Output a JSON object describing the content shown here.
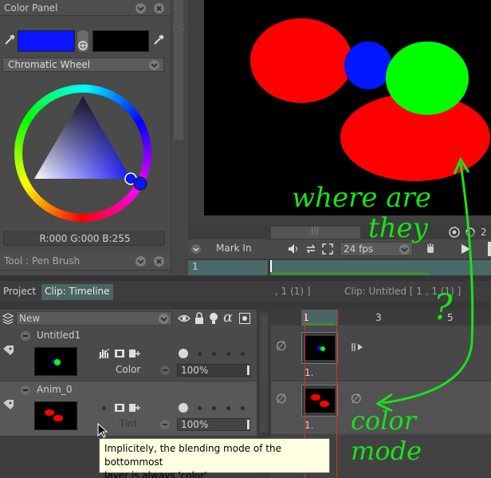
{
  "color_panel": {
    "title": "Color Panel",
    "mode_select": "Chromatic Wheel",
    "rgb_readout": "R:000 G:000 B:255",
    "primary_color": "#0a14ff",
    "secondary_color": "#000000"
  },
  "tool_panel": {
    "title": "Tool : Pen Brush"
  },
  "transport": {
    "mark_in": "Mark In",
    "fps": "24 fps",
    "current_frame": "1",
    "scroll_value": "2"
  },
  "tabs": {
    "project": "Project",
    "clip_timeline": "Clip: Timeline"
  },
  "timeline_status": {
    "frame_info": ", 1  (1)  ]",
    "clip_info": "Clip: Untitled [ 1 , 1  (1) ]"
  },
  "layer_header": {
    "new_label": "New",
    "frame_numbers": [
      "1",
      "3",
      "5"
    ]
  },
  "layers": [
    {
      "name": "Untitled1",
      "blend_mode": "Color",
      "opacity": "100%",
      "frame_label": "1."
    },
    {
      "name": "Anim_0",
      "blend_mode": "Tint",
      "opacity": "100%",
      "frame_label": "1."
    }
  ],
  "tooltip": {
    "line1": "Implicitely, the blending mode of the bottommost",
    "line2": "layer is always 'color'"
  },
  "annotations": {
    "where": "where are",
    "they": "they",
    "question": "?",
    "color_mode": "color mode"
  }
}
